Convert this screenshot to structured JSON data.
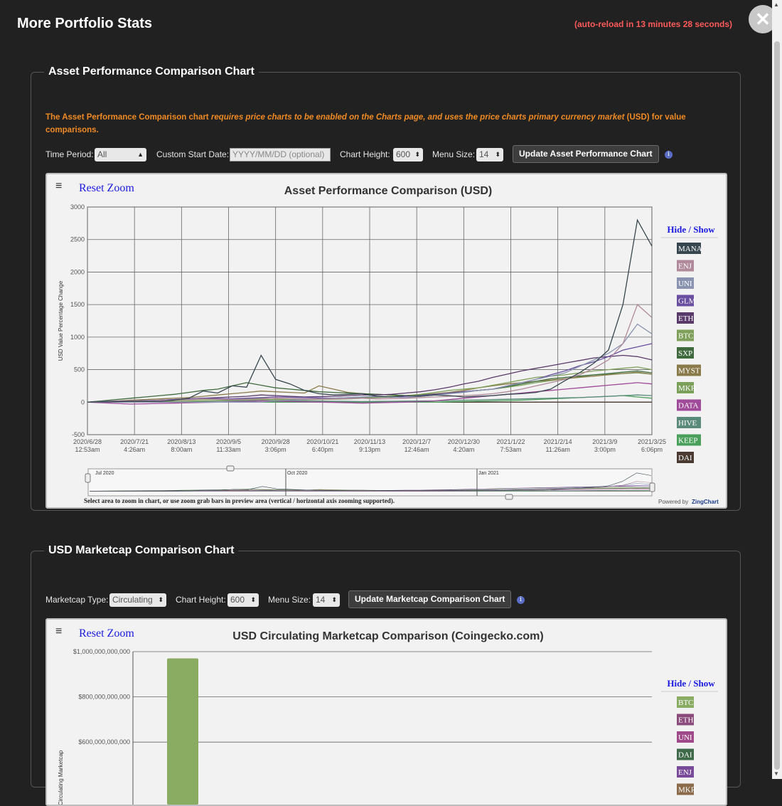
{
  "page": {
    "title": "More Portfolio Stats",
    "reload_notice": "(auto-reload in 13 minutes 28 seconds)",
    "close_glyph": "✕"
  },
  "asset_section": {
    "legend": "Asset Performance Comparison Chart",
    "note_a": "The Asset Performance Comparison chart ",
    "note_b": "requires price charts to be enabled on the Charts page, and uses the price charts primary currency market",
    "note_c": " (USD) for value comparisons.",
    "time_period_label": "Time Period:",
    "time_period_value": "All",
    "start_date_label": "Custom Start Date:",
    "start_date_placeholder": "YYYY/MM/DD (optional)",
    "chart_height_label": "Chart Height:",
    "chart_height_value": "600",
    "menu_size_label": "Menu Size:",
    "menu_size_value": "14",
    "update_button": "Update Asset Performance Chart",
    "info_glyph": "i"
  },
  "asset_chart": {
    "reset_zoom": "Reset Zoom",
    "hide_show": "Hide / Show",
    "zoom_hint": "Select area to zoom in chart, or use zoom grab bars in preview area (vertical / horizontal axis zooming supported).",
    "powered_by": "Powered by ",
    "zingchart": "ZingChart",
    "preview_labels": [
      "Jul 2020",
      "Oct 2020",
      "Jan 2021"
    ],
    "menu_glyph": "≡"
  },
  "chart_data": [
    {
      "type": "line",
      "title": "Asset Performance Comparison (USD)",
      "xlabel": "",
      "ylabel": "USD Value Percentage Change",
      "ylim": [
        -500,
        3000
      ],
      "y_ticks": [
        "3000",
        "2500",
        "2000",
        "1500",
        "1000",
        "500",
        "0",
        "-500"
      ],
      "x_ticks": [
        [
          "2020/6/28",
          "12:53am"
        ],
        [
          "2020/7/21",
          "4:26am"
        ],
        [
          "2020/8/13",
          "8:00am"
        ],
        [
          "2020/9/5",
          "11:33am"
        ],
        [
          "2020/9/28",
          "3:06pm"
        ],
        [
          "2020/10/21",
          "6:40pm"
        ],
        [
          "2020/11/13",
          "9:13pm"
        ],
        [
          "2020/12/7",
          "12:46am"
        ],
        [
          "2020/12/30",
          "4:20am"
        ],
        [
          "2021/1/22",
          "7:53am"
        ],
        [
          "2021/2/14",
          "11:26am"
        ],
        [
          "2021/3/9",
          "3:00pm"
        ],
        [
          "2021/3/25",
          "6:06pm"
        ]
      ],
      "grid": true,
      "legend_position": "right",
      "series": [
        {
          "name": "MANA",
          "color": "#37474f",
          "values": [
            0,
            5,
            8,
            10,
            12,
            10,
            30,
            60,
            170,
            140,
            250,
            230,
            720,
            350,
            280,
            180,
            130,
            110,
            120,
            130,
            90,
            80,
            100,
            90,
            110,
            100,
            80,
            90,
            100,
            120,
            130,
            150,
            200,
            330,
            450,
            600,
            800,
            1500,
            2800,
            2400
          ]
        },
        {
          "name": "ENJ",
          "color": "#b08a9a",
          "values": [
            0,
            5,
            10,
            15,
            20,
            25,
            30,
            40,
            50,
            45,
            40,
            40,
            50,
            60,
            55,
            50,
            45,
            50,
            55,
            60,
            50,
            55,
            60,
            70,
            80,
            90,
            100,
            110,
            130,
            160,
            200,
            250,
            300,
            350,
            420,
            520,
            650,
            900,
            1500,
            1300
          ]
        },
        {
          "name": "UNI",
          "color": "#8a94b0",
          "values": [
            0,
            0,
            0,
            0,
            0,
            0,
            0,
            0,
            0,
            0,
            0,
            0,
            0,
            20,
            30,
            40,
            50,
            60,
            70,
            80,
            90,
            80,
            70,
            90,
            110,
            130,
            150,
            180,
            200,
            250,
            300,
            350,
            400,
            450,
            550,
            650,
            750,
            900,
            1200,
            1050
          ]
        },
        {
          "name": "GLM",
          "color": "#6a4fa0",
          "values": [
            0,
            10,
            15,
            20,
            25,
            30,
            40,
            50,
            60,
            55,
            50,
            60,
            70,
            80,
            75,
            70,
            65,
            60,
            70,
            80,
            85,
            80,
            90,
            100,
            120,
            140,
            160,
            180,
            200,
            250,
            300,
            350,
            420,
            480,
            560,
            620,
            700,
            800,
            850,
            900
          ]
        },
        {
          "name": "ETH",
          "color": "#5a3a6a",
          "values": [
            0,
            5,
            10,
            15,
            20,
            30,
            40,
            50,
            60,
            70,
            80,
            90,
            110,
            100,
            90,
            80,
            85,
            90,
            100,
            110,
            110,
            120,
            140,
            160,
            190,
            230,
            280,
            320,
            380,
            430,
            480,
            520,
            560,
            600,
            640,
            680,
            700,
            720,
            700,
            650
          ]
        },
        {
          "name": "BTC",
          "color": "#7fa05a",
          "values": [
            0,
            2,
            4,
            6,
            8,
            10,
            12,
            15,
            20,
            25,
            30,
            35,
            40,
            38,
            36,
            35,
            40,
            45,
            50,
            60,
            70,
            80,
            100,
            120,
            150,
            180,
            200,
            220,
            260,
            300,
            340,
            380,
            400,
            420,
            450,
            480,
            500,
            520,
            540,
            500
          ]
        },
        {
          "name": "SXP",
          "color": "#3e6a3e",
          "values": [
            0,
            20,
            40,
            60,
            80,
            100,
            120,
            150,
            180,
            200,
            250,
            300,
            260,
            220,
            200,
            180,
            160,
            150,
            140,
            130,
            120,
            110,
            100,
            110,
            120,
            140,
            160,
            180,
            200,
            240,
            280,
            320,
            360,
            380,
            400,
            420,
            440,
            460,
            480,
            450
          ]
        },
        {
          "name": "MYST",
          "color": "#8a7a4a",
          "values": [
            0,
            10,
            20,
            30,
            40,
            50,
            60,
            70,
            90,
            110,
            130,
            150,
            170,
            160,
            150,
            140,
            250,
            200,
            150,
            130,
            120,
            110,
            100,
            110,
            130,
            150,
            180,
            220,
            250,
            280,
            300,
            320,
            340,
            360,
            380,
            400,
            420,
            440,
            460,
            430
          ]
        },
        {
          "name": "MKR",
          "color": "#7aa05a",
          "values": [
            0,
            5,
            10,
            15,
            20,
            25,
            30,
            35,
            40,
            45,
            50,
            55,
            60,
            55,
            50,
            45,
            50,
            55,
            60,
            70,
            80,
            90,
            100,
            110,
            120,
            140,
            160,
            180,
            200,
            230,
            260,
            300,
            330,
            360,
            390,
            420,
            430,
            440,
            450,
            430
          ]
        },
        {
          "name": "DATA",
          "color": "#a04a9a",
          "values": [
            0,
            -10,
            -20,
            -30,
            -25,
            -20,
            -15,
            -10,
            -5,
            0,
            5,
            10,
            20,
            15,
            10,
            5,
            0,
            -5,
            -10,
            -15,
            -10,
            -5,
            0,
            10,
            20,
            40,
            60,
            80,
            100,
            120,
            140,
            160,
            180,
            200,
            220,
            240,
            260,
            280,
            300,
            280
          ]
        },
        {
          "name": "HIVE",
          "color": "#5a8a7a",
          "values": [
            0,
            2,
            4,
            6,
            8,
            10,
            12,
            14,
            16,
            18,
            20,
            22,
            24,
            22,
            20,
            18,
            16,
            14,
            12,
            10,
            12,
            14,
            16,
            18,
            20,
            25,
            30,
            35,
            40,
            45,
            50,
            55,
            60,
            65,
            70,
            80,
            90,
            100,
            110,
            100
          ]
        },
        {
          "name": "KEEP",
          "color": "#4aa05a",
          "values": [
            0,
            0,
            0,
            0,
            0,
            0,
            0,
            0,
            0,
            0,
            0,
            0,
            0,
            0,
            0,
            0,
            0,
            0,
            0,
            0,
            0,
            0,
            0,
            0,
            0,
            5,
            10,
            15,
            20,
            25,
            30,
            40,
            50,
            60,
            70,
            80,
            90,
            100,
            80,
            60
          ]
        },
        {
          "name": "DAI",
          "color": "#4a3a32",
          "values": [
            0,
            0,
            0,
            0,
            0,
            0,
            0,
            0,
            0,
            0,
            0,
            0,
            0,
            0,
            0,
            0,
            0,
            0,
            0,
            0,
            0,
            0,
            0,
            0,
            0,
            0,
            0,
            0,
            0,
            0,
            0,
            0,
            0,
            0,
            0,
            0,
            0,
            0,
            0,
            0
          ]
        }
      ]
    },
    {
      "type": "bar",
      "title": "USD Circulating Marketcap Comparison (Coingecko.com)",
      "xlabel": "",
      "ylabel": "USD Circulating Marketcap",
      "ylim": [
        0,
        1000000000000
      ],
      "y_ticks": [
        "$1,000,000,000,000",
        "$800,000,000,000",
        "$600,000,000,000"
      ],
      "categories": [
        "BTC"
      ],
      "values": [
        970000000000
      ],
      "bar_color": "#8aab62",
      "legend_position": "right",
      "legend_items": [
        {
          "name": "BTC",
          "color": "#8aab62"
        },
        {
          "name": "ETH",
          "color": "#8a4a7a"
        },
        {
          "name": "UNI",
          "color": "#a04a8a"
        },
        {
          "name": "DAI",
          "color": "#3e6a4a"
        },
        {
          "name": "ENJ",
          "color": "#7a4a9a"
        },
        {
          "name": "MKR",
          "color": "#8a6a4a"
        }
      ]
    }
  ],
  "marketcap_section": {
    "legend": "USD Marketcap Comparison Chart",
    "type_label": "Marketcap Type:",
    "type_value": "Circulating",
    "chart_height_label": "Chart Height:",
    "chart_height_value": "600",
    "menu_size_label": "Menu Size:",
    "menu_size_value": "14",
    "update_button": "Update Marketcap Comparison Chart",
    "info_glyph": "i"
  },
  "marketcap_chart": {
    "reset_zoom": "Reset Zoom",
    "hide_show": "Hide / Show",
    "menu_glyph": "≡"
  }
}
